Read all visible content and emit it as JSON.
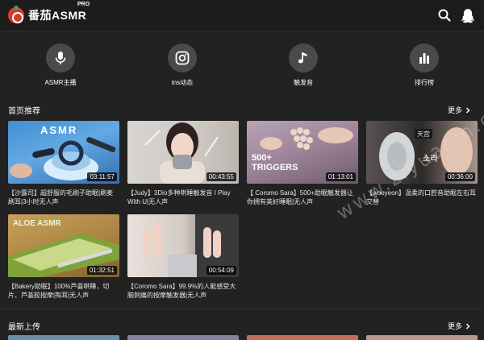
{
  "header": {
    "logo_text": "番茄ASMR",
    "logo_badge": "PRO",
    "search_icon": "search-icon",
    "qq_icon": "qq-penguin-icon"
  },
  "categories": [
    {
      "label": "ASMR主播",
      "icon": "microphone-icon"
    },
    {
      "label": "ins动态",
      "icon": "instagram-icon"
    },
    {
      "label": "触发音",
      "icon": "music-note-icon"
    },
    {
      "label": "排行榜",
      "icon": "bar-chart-icon"
    }
  ],
  "sections": {
    "home": {
      "title": "首页推荐",
      "more": "更多"
    },
    "latest": {
      "title": "最新上传",
      "more": "更多"
    }
  },
  "videos": [
    {
      "duration": "03:11:57",
      "title": "【沙露司】超舒服的毛刷子助眠|刷麦刷耳|3小时无人声",
      "thumb_text": "ASMR"
    },
    {
      "duration": "00:43:55",
      "title": "【Judy】3Dio多种哄睡触发音 I Play With U|无人声",
      "thumb_text": ""
    },
    {
      "duration": "01:13:01",
      "title": "【 Coromo Sara】500+助眠触发器让你拥有美好睡眠|无人声",
      "thumb_text": "500+ TRIGGERS"
    },
    {
      "duration": "00:36:00",
      "title": "【wooyeon】温柔的口腔音助眠左右耳交替",
      "thumb_text": "소리"
    },
    {
      "duration": "01:32:51",
      "title": "【Bakery助眠】100%芦荟哄睡，切片、芦荟胶按摩|掏耳|无人声",
      "thumb_text": "ALOE ASMR"
    },
    {
      "duration": "00:54:09",
      "title": "【Coromo Sara】99.9%的人能感受大脑刺痛的按摩触发器|无人声",
      "thumb_text": ""
    }
  ],
  "watermark": "www.ziyuanm.com",
  "colors": {
    "background": "#222222",
    "header": "#1c1c1c",
    "icon_circle": "#4a4a4a",
    "brand_red": "#d63a2f"
  }
}
